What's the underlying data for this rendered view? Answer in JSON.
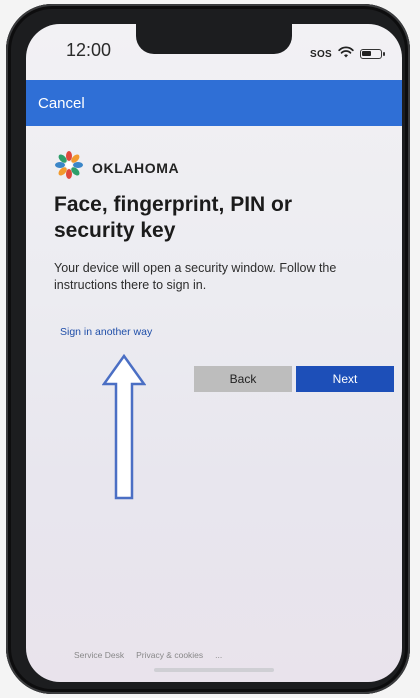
{
  "status_bar": {
    "time": "12:00",
    "sos": "SOS",
    "battery_level": 0.55
  },
  "nav": {
    "cancel_label": "Cancel"
  },
  "brand": {
    "name": "OKLAHOMA"
  },
  "page": {
    "title": "Face, fingerprint, PIN or security key",
    "description": "Your device will open a security window. Follow the instructions there to sign in.",
    "alt_signin_link": "Sign in another way"
  },
  "buttons": {
    "back_label": "Back",
    "next_label": "Next"
  },
  "footer": {
    "service_desk": "Service Desk",
    "privacy": "Privacy & cookies",
    "more": "..."
  },
  "colors": {
    "nav_bar": "#2f6fd6",
    "next_button": "#1d4fb8",
    "back_button": "#bdbdbd",
    "link": "#1f4ea8",
    "annotation_arrow": "#4b6fc4"
  }
}
